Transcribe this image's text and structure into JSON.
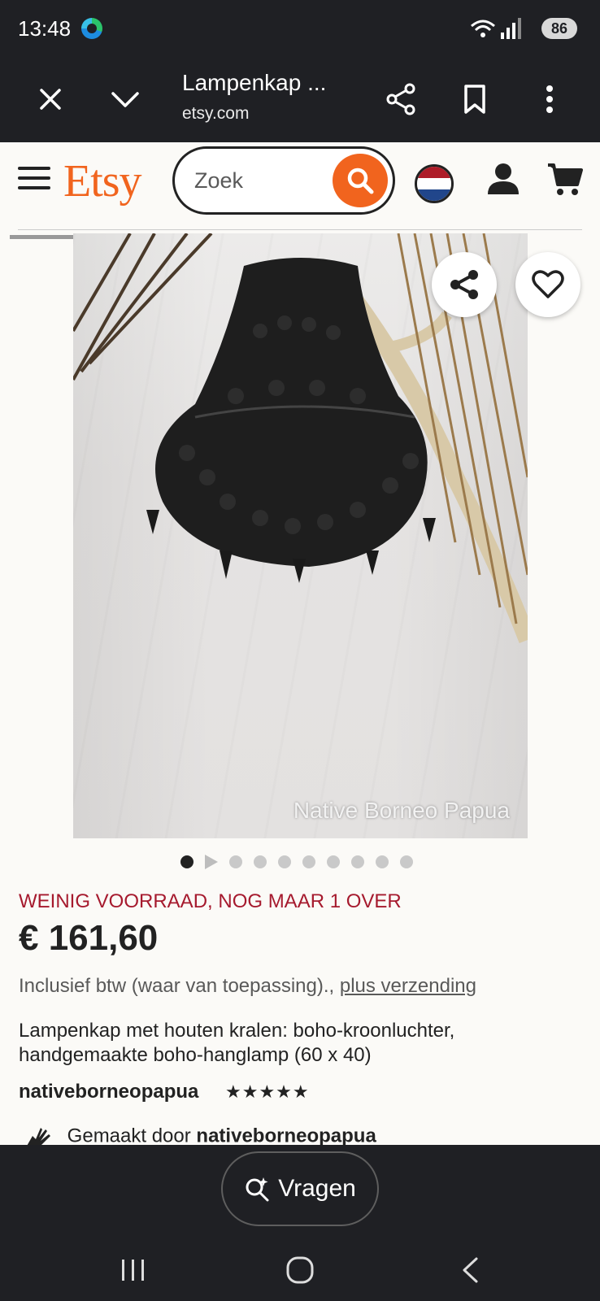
{
  "status_bar": {
    "time": "13:48",
    "battery": "86",
    "icons": [
      "edge-icon",
      "wifi-icon",
      "signal-icon",
      "battery-icon"
    ]
  },
  "browser": {
    "title": "Lampenkap ...",
    "domain": "etsy.com",
    "icons": [
      "close-icon",
      "chevron-down-icon",
      "share-icon",
      "bookmark-icon",
      "more-vertical-icon"
    ]
  },
  "etsy_header": {
    "logo": "Etsy",
    "search_placeholder": "Zoek",
    "icons": [
      "menu-icon",
      "search-icon",
      "flag-nl-icon",
      "user-icon",
      "cart-icon"
    ],
    "brand_color": "#f1641e"
  },
  "product": {
    "watermark": "Native Borneo Papua",
    "image_count": 10,
    "active_image": 1,
    "stock_notice": "WEINIG VOORRAAD, NOG MAAR 1 OVER",
    "price": "€ 161,60",
    "vat_text": "Inclusief btw (waar van toepassing).,",
    "shipping_link": "plus verzending",
    "title": "Lampenkap met houten kralen: boho-kroonluchter, handgemaakte boho-hanglamp (60 x 40)",
    "shop_name": "nativeborneopapua",
    "rating_stars": "★★★★★",
    "rating": 5,
    "made_by_prefix": "Gemaakt door",
    "made_by_shop": "nativeborneopapua",
    "stock_color": "#a61a2e"
  },
  "bottom": {
    "ask_label": "Vragen",
    "nav_icons": [
      "recent-apps-icon",
      "home-icon",
      "back-icon"
    ]
  }
}
